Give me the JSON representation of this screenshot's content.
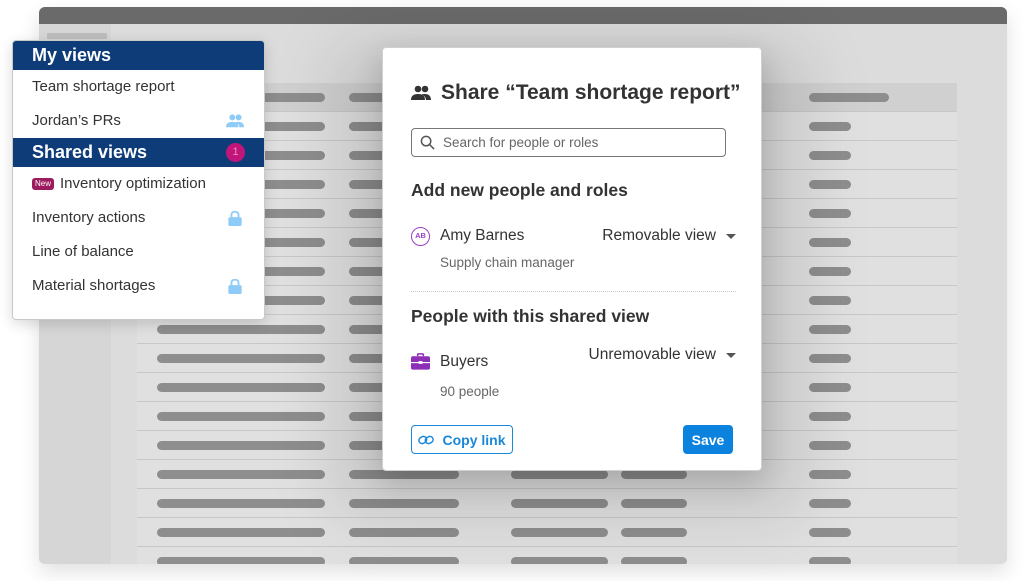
{
  "views_menu": {
    "my_views_header": "My views",
    "my_views": [
      {
        "label": "Team shortage report",
        "icon": null
      },
      {
        "label": "Jordan’s PRs",
        "icon": "people-icon"
      }
    ],
    "shared_views_header": "Shared views",
    "shared_views_badge": "1",
    "shared_views": [
      {
        "label": "Inventory optimization",
        "tag": "New",
        "icon": null
      },
      {
        "label": "Inventory actions",
        "icon": "lock-icon"
      },
      {
        "label": "Line of balance",
        "icon": null
      },
      {
        "label": "Material shortages",
        "icon": "lock-icon"
      }
    ]
  },
  "share_dialog": {
    "title": "Share “Team shortage report”",
    "title_icon": "people-icon",
    "search_placeholder": "Search for people or roles",
    "add_section_title": "Add new people and roles",
    "new_people": [
      {
        "initials": "AB",
        "name": "Amy Barnes",
        "subtitle": "Supply chain manager",
        "permission": "Removable view"
      }
    ],
    "shared_section_title": "People with this shared view",
    "shared_with": [
      {
        "icon": "briefcase-icon",
        "name": "Buyers",
        "subtitle": "90 people",
        "permission": "Unremovable view"
      }
    ],
    "copy_link_label": "Copy link",
    "save_label": "Save"
  },
  "colors": {
    "menu_header": "#0d3c78",
    "badge": "#c2157a",
    "new_tag": "#9c1a5e",
    "icon_light_blue": "#8ecbf8",
    "primary": "#0b83de",
    "avatar_purple": "#9b3fc7"
  }
}
